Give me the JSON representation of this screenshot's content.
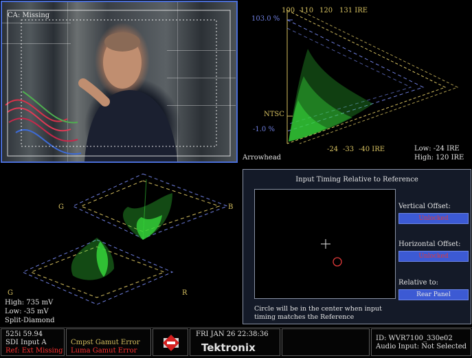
{
  "video": {
    "caption": "CA: Missing"
  },
  "arrowhead": {
    "ire_top": [
      "100",
      "110",
      "120",
      "131 IRE"
    ],
    "pct_top": "103.0 %",
    "standard": "NTSC",
    "pct_bottom": "-1.0 %",
    "ire_bottom": [
      "-24",
      "-33",
      "-40 IRE"
    ],
    "title": "Arrowhead",
    "low": "Low: -24 IRE",
    "high": "High: 120 IRE"
  },
  "diamond": {
    "label_g_top": "G",
    "label_b": "B",
    "label_g_bottom": "G",
    "label_r": "R",
    "high": "High: 735 mV",
    "low": "Low: -35 mV",
    "title": "Split-Diamond"
  },
  "timing": {
    "title": "Input Timing Relative to Reference",
    "vertical_label": "Vertical Offset:",
    "vertical_value": "Unlocked",
    "horizontal_label": "Horizontal Offset:",
    "horizontal_value": "Unlocked",
    "relative_label": "Relative to:",
    "relative_value": "Rear Panel",
    "note_line1": "Circle will be in the center when input",
    "note_line2": "timing matches the Reference"
  },
  "status": {
    "format": "525i 59.94",
    "input": "SDI Input A",
    "ref": "Ref: Ext Missing",
    "cmpst": "Cmpst Gamut Error",
    "luma": "Luma Gamut Error",
    "datetime": "FRI JAN 26 22:38:36",
    "brand": "Tektronix",
    "id": "ID: WVR7100_330e02",
    "audio": "Audio Input: Not Selected"
  },
  "colors": {
    "trace": "#36d43a",
    "graticule_yellow": "#d6c060",
    "graticule_blue": "#6f7fe0",
    "error": "#ff3030"
  }
}
